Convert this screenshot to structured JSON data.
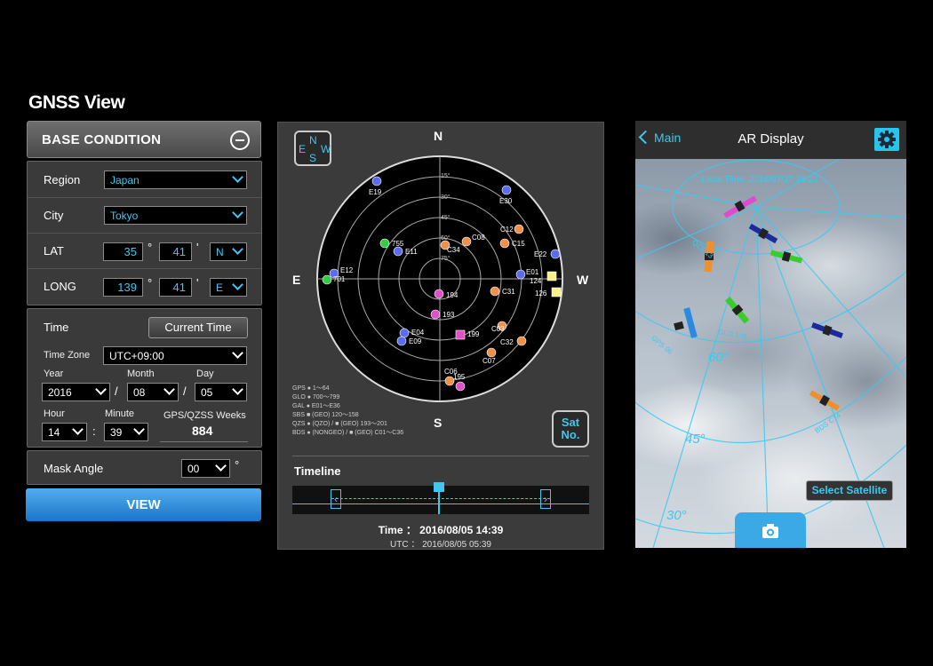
{
  "app": {
    "title": "GNSS View"
  },
  "base_condition": {
    "header": "BASE CONDITION",
    "region_label": "Region",
    "region_value": "Japan",
    "city_label": "City",
    "city_value": "Tokyo",
    "lat_label": "LAT",
    "lat_deg": "35",
    "lat_min": "41",
    "lat_dir": "N",
    "long_label": "LONG",
    "long_deg": "139",
    "long_min": "41",
    "long_dir": "E",
    "deg_symbol": "°",
    "min_symbol": "'"
  },
  "time_section": {
    "time_label": "Time",
    "current_time_button": "Current Time",
    "time_zone_label": "Time Zone",
    "time_zone_value": "UTC+09:00",
    "year_label": "Year",
    "month_label": "Month",
    "day_label": "Day",
    "year_value": "2016",
    "month_value": "08",
    "day_value": "05",
    "date_sep": "/",
    "hour_label": "Hour",
    "minute_label": "Minute",
    "hour_value": "14",
    "minute_value": "39",
    "time_sep": ":",
    "weeks_label": "GPS/QZSS Weeks",
    "weeks_value": "884"
  },
  "mask": {
    "label": "Mask Angle",
    "value": "00",
    "unit": "°"
  },
  "view_button": "VIEW",
  "skyplot": {
    "compass": {
      "n": "N",
      "e": "E",
      "w": "W",
      "s": "S"
    },
    "cardinals": {
      "n": "N",
      "s": "S",
      "e": "E",
      "w": "W"
    },
    "rings": [
      "15°",
      "30°",
      "45°",
      "60°",
      "75°"
    ],
    "satellites": [
      {
        "id": "E19",
        "color": "#5a6cf0",
        "shape": "dot"
      },
      {
        "id": "E30",
        "color": "#5a6cf0",
        "shape": "dot"
      },
      {
        "id": "755",
        "color": "#33cc44",
        "shape": "dot"
      },
      {
        "id": "E11",
        "color": "#5a6cf0",
        "shape": "dot"
      },
      {
        "id": "C12",
        "color": "#f0904a",
        "shape": "dot"
      },
      {
        "id": "C08",
        "color": "#f0904a",
        "shape": "dot"
      },
      {
        "id": "C34",
        "color": "#f0904a",
        "shape": "dot"
      },
      {
        "id": "C15",
        "color": "#f0904a",
        "shape": "dot"
      },
      {
        "id": "E22",
        "color": "#5a6cf0",
        "shape": "dot"
      },
      {
        "id": "E12",
        "color": "#5a6cf0",
        "shape": "dot"
      },
      {
        "id": "701",
        "color": "#33cc44",
        "shape": "dot"
      },
      {
        "id": "E01",
        "color": "#5a6cf0",
        "shape": "dot"
      },
      {
        "id": "124",
        "color": "#f5f08a",
        "shape": "square"
      },
      {
        "id": "126",
        "color": "#f5f08a",
        "shape": "square"
      },
      {
        "id": "194",
        "color": "#e050c8",
        "shape": "dot"
      },
      {
        "id": "C31",
        "color": "#f0904a",
        "shape": "dot"
      },
      {
        "id": "193",
        "color": "#e050c8",
        "shape": "dot"
      },
      {
        "id": "E04",
        "color": "#5a6cf0",
        "shape": "dot"
      },
      {
        "id": "E09",
        "color": "#5a6cf0",
        "shape": "dot"
      },
      {
        "id": "C03",
        "color": "#f0904a",
        "shape": "dot"
      },
      {
        "id": "199",
        "color": "#e050c8",
        "shape": "square"
      },
      {
        "id": "C32",
        "color": "#f0904a",
        "shape": "dot"
      },
      {
        "id": "C07",
        "color": "#f0904a",
        "shape": "dot"
      },
      {
        "id": "C06",
        "color": "#f0904a",
        "shape": "dot"
      },
      {
        "id": "195",
        "color": "#e050c8",
        "shape": "dot"
      }
    ],
    "legend": [
      "GPS ● 1～64",
      "GLO ● 700～799",
      "GAL ● E01～E36",
      "SBS ■ (GEO) 120～158",
      "QZS ● (QZO) / ■ (GEO) 193～201",
      "BDS ● (NONGEO) / ■ (GEO) C01～C36"
    ],
    "sat_no_button": [
      "Sat",
      "No."
    ]
  },
  "timeline": {
    "label": "Timeline",
    "time_line": "Time ： 2016/08/05 14:39",
    "utc_line": "UTC ： 2016/08/05 05:39",
    "position_fraction": 0.49
  },
  "ar": {
    "back_label": "Main",
    "title": "AR Display",
    "local_time": "Local Time: 2016/07/27 18:21",
    "labels": {
      "gps_label": "GPS 06",
      "qzs_label": "QZS 13",
      "gal_label": "GLO 145",
      "bds_label": "BDS C14"
    },
    "elevation_labels": [
      "60°",
      "45°",
      "30°"
    ],
    "select_button": "Select Satellite"
  },
  "colors": {
    "accent": "#3ec8f0",
    "view_button": "#2a8ae0",
    "gear": "#27c5ee"
  }
}
